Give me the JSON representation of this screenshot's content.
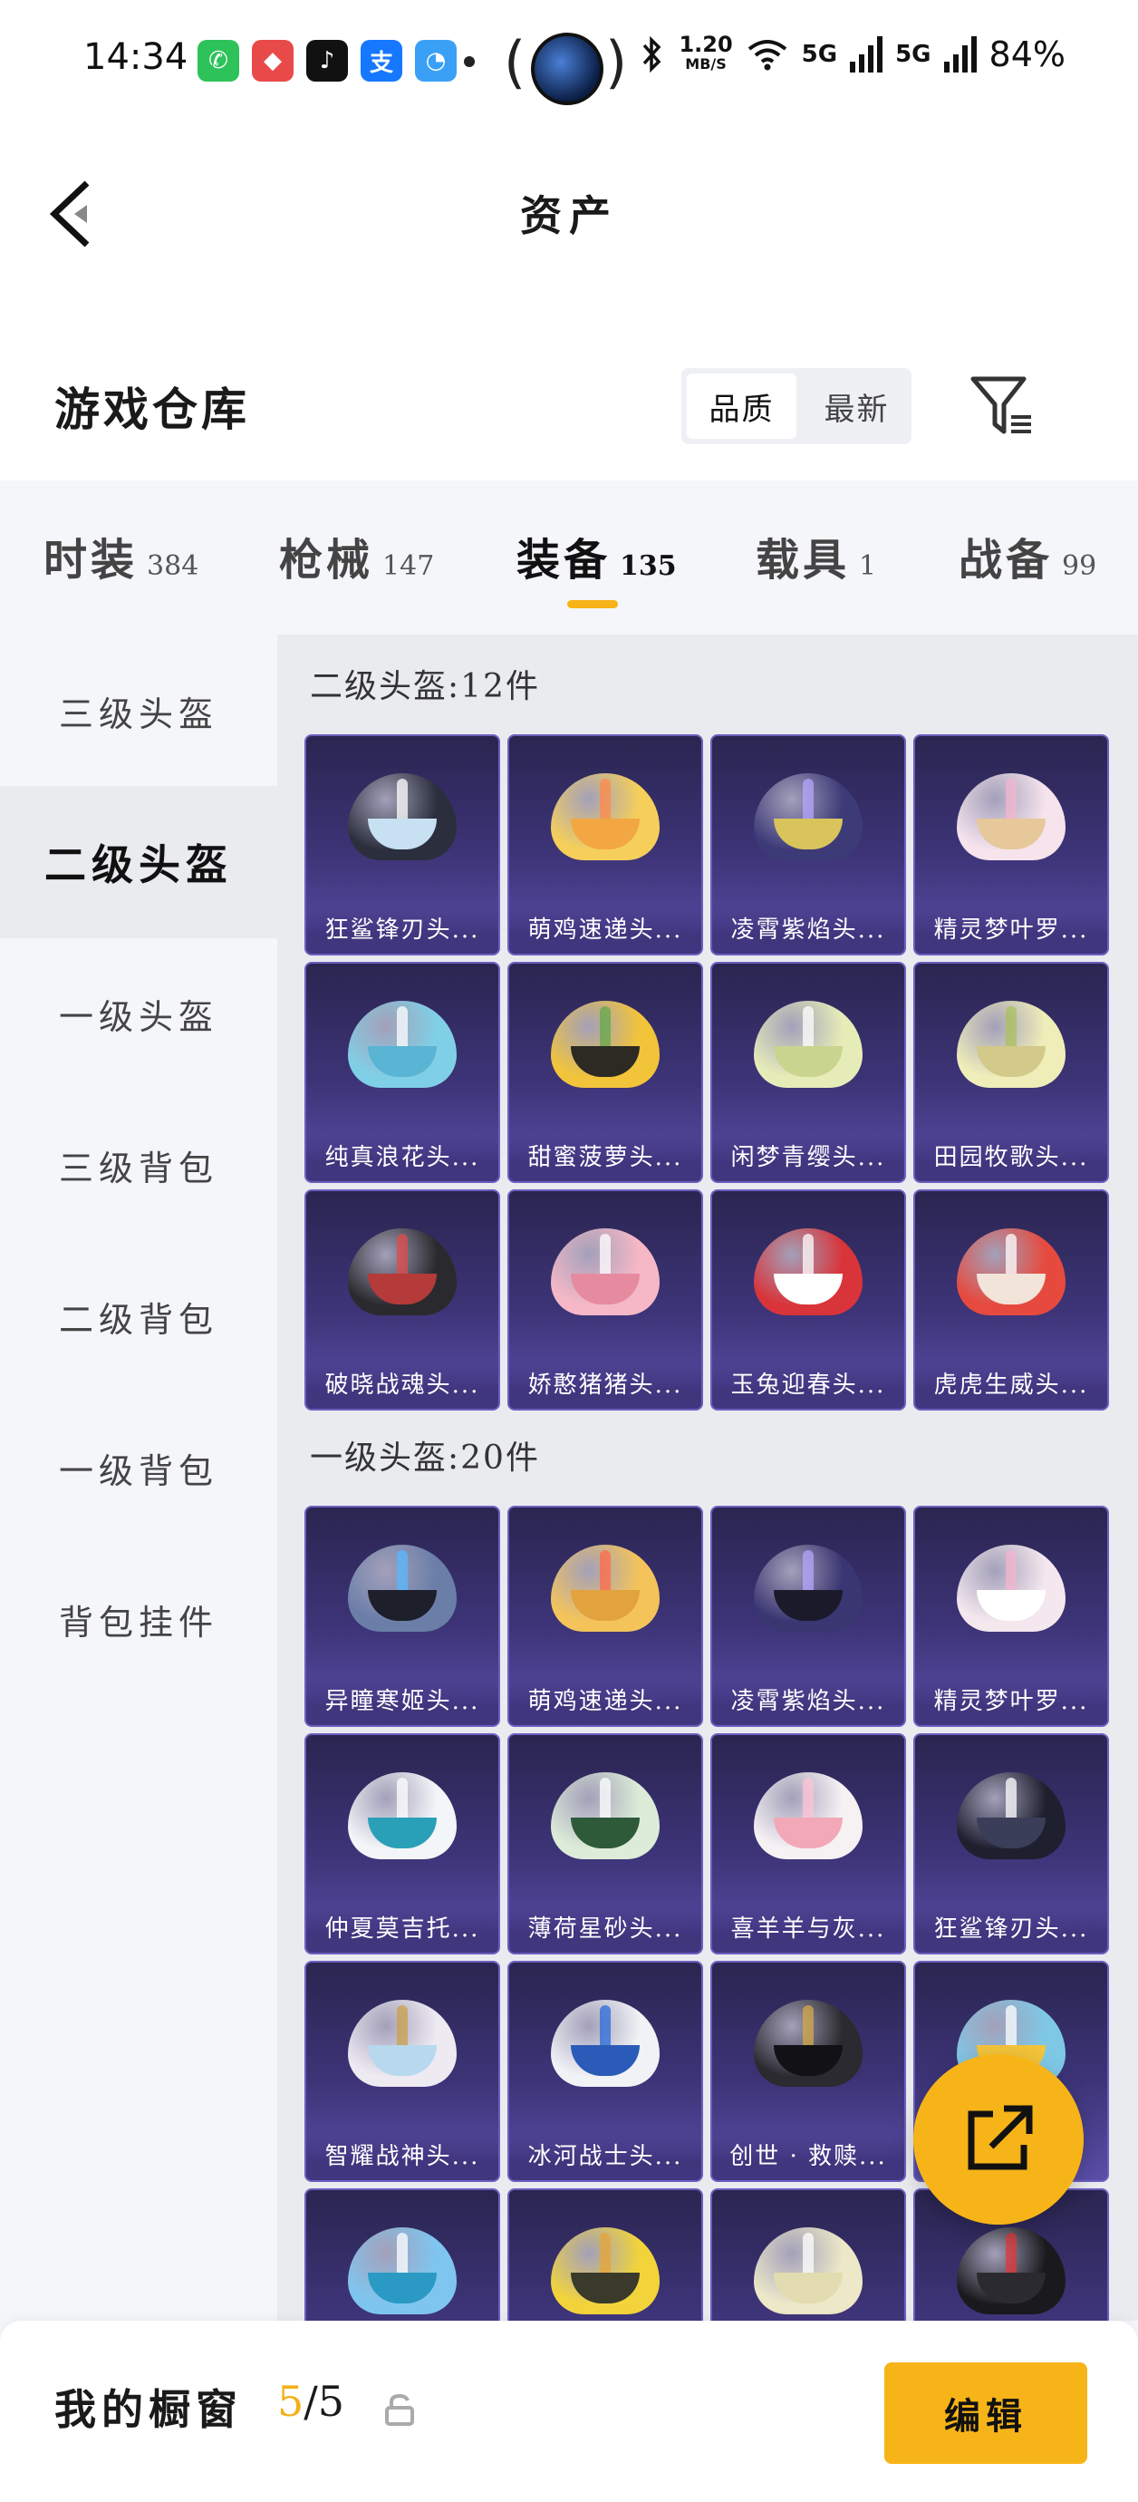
{
  "status_bar": {
    "time": "14:34",
    "speed_value": "1.20",
    "speed_unit": "MB/S",
    "signal1": "5G",
    "signal2": "5G",
    "battery": "84%",
    "apps": [
      {
        "icon": "wechat-icon",
        "glyph": "✆",
        "color": "#2ec25a"
      },
      {
        "icon": "game-app-icon",
        "glyph": "◆",
        "color": "#e84a4a"
      },
      {
        "icon": "tiktok-icon",
        "glyph": "♪",
        "color": "#111111"
      },
      {
        "icon": "alipay-icon",
        "glyph": "支",
        "color": "#1677ff"
      },
      {
        "icon": "browser-icon",
        "glyph": "◔",
        "color": "#3aa0f5"
      }
    ]
  },
  "header": {
    "title": "资产"
  },
  "section": {
    "title": "游戏仓库",
    "sort_options": [
      "品质",
      "最新"
    ],
    "sort_active": "品质"
  },
  "category_tabs": [
    {
      "label": "时装",
      "count": "384",
      "active": false
    },
    {
      "label": "枪械",
      "count": "147",
      "active": false
    },
    {
      "label": "装备",
      "count": "135",
      "active": true
    },
    {
      "label": "载具",
      "count": "1",
      "active": false
    },
    {
      "label": "战备",
      "count": "99",
      "active": false
    }
  ],
  "sidebar": {
    "items": [
      "三级头盔",
      "二级头盔",
      "一级头盔",
      "三级背包",
      "二级背包",
      "一级背包",
      "背包挂件"
    ],
    "active_index": 1
  },
  "groups": [
    {
      "title": "二级头盔:12件",
      "items": [
        {
          "name": "狂鲨锋刃头...",
          "color": "#2b2f3d",
          "visor": "#c7e0f2",
          "stripe": "#ffffff"
        },
        {
          "name": "萌鸡速递头...",
          "color": "#f6cf5a",
          "visor": "#f2a742",
          "stripe": "#ff8a4a"
        },
        {
          "name": "凌霄紫焰头...",
          "color": "#3d3a78",
          "visor": "#d9c35b",
          "stripe": "#b6a6ff"
        },
        {
          "name": "精灵梦叶罗...",
          "color": "#f6e3ec",
          "visor": "#e6c89a",
          "stripe": "#f2b6cf"
        },
        {
          "name": "纯真浪花头...",
          "color": "#7fd0e6",
          "visor": "#5ab4d4",
          "stripe": "#ffffff"
        },
        {
          "name": "甜蜜菠萝头...",
          "color": "#f2c43a",
          "visor": "#2d2a24",
          "stripe": "#63a84a"
        },
        {
          "name": "闲梦青缨头...",
          "color": "#e6ecb8",
          "visor": "#c9d48e",
          "stripe": "#ffffff"
        },
        {
          "name": "田园牧歌头...",
          "color": "#f0eeb8",
          "visor": "#d2c98a",
          "stripe": "#a9c25c"
        },
        {
          "name": "破晓战魂头...",
          "color": "#2a2a2e",
          "visor": "#b53a3a",
          "stripe": "#e14a4a"
        },
        {
          "name": "娇憨猪猪头...",
          "color": "#f6b8c6",
          "visor": "#e68aa0",
          "stripe": "#ffffff"
        },
        {
          "name": "玉兔迎春头...",
          "color": "#d8343a",
          "visor": "#ffffff",
          "stripe": "#ffffff"
        },
        {
          "name": "虎虎生威头...",
          "color": "#e64a3e",
          "visor": "#f2e4d8",
          "stripe": "#ffffff"
        }
      ]
    },
    {
      "title": "一级头盔:20件",
      "items": [
        {
          "name": "异瞳寒姬头...",
          "color": "#6a7ea8",
          "visor": "#1d1f2a",
          "stripe": "#58b8ff"
        },
        {
          "name": "萌鸡速递头...",
          "color": "#f4c45a",
          "visor": "#e2a23e",
          "stripe": "#ff6a4a"
        },
        {
          "name": "凌霄紫焰头...",
          "color": "#3a3672",
          "visor": "#1a1a2a",
          "stripe": "#b6a6ff"
        },
        {
          "name": "精灵梦叶罗...",
          "color": "#f4e8ee",
          "visor": "#ffffff",
          "stripe": "#f2b6cf"
        },
        {
          "name": "仲夏莫吉托...",
          "color": "#f2f6f8",
          "visor": "#2aa0b8",
          "stripe": "#ffffff"
        },
        {
          "name": "薄荷星砂头...",
          "color": "#dcecd8",
          "visor": "#2e5a3a",
          "stripe": "#ffffff"
        },
        {
          "name": "喜羊羊与灰...",
          "color": "#f6f2f4",
          "visor": "#f2a8b6",
          "stripe": "#ffc4d4"
        },
        {
          "name": "狂鲨锋刃头...",
          "color": "#1e2030",
          "visor": "#3a3e58",
          "stripe": "#ffffff"
        },
        {
          "name": "智耀战神头...",
          "color": "#eeeaf2",
          "visor": "#b8d8ee",
          "stripe": "#c9a04a"
        },
        {
          "name": "冰河战士头...",
          "color": "#f0f2f6",
          "visor": "#2a5bb8",
          "stripe": "#2a6ad8"
        },
        {
          "name": "创世 · 救赎...",
          "color": "#2a2a30",
          "visor": "#111116",
          "stripe": "#d6a84a"
        },
        {
          "name": "",
          "color": "#7ec8e6",
          "visor": "#f2c43a",
          "stripe": "#ffffff"
        },
        {
          "name": "",
          "color": "#7ec6f0",
          "visor": "#2a9ac4",
          "stripe": "#ffffff"
        },
        {
          "name": "",
          "color": "#f2d43a",
          "visor": "#3a3a2a",
          "stripe": "#e6a43a"
        },
        {
          "name": "",
          "color": "#ece8c8",
          "visor": "#e2dcb0",
          "stripe": "#ffffff"
        },
        {
          "name": "",
          "color": "#1a1a1e",
          "visor": "#2a2a30",
          "stripe": "#e0383a"
        }
      ]
    }
  ],
  "bottom": {
    "showcase_label": "我的橱窗",
    "showcase_current": "5",
    "showcase_sep": "/5",
    "edit_label": "编辑"
  },
  "colors": {
    "accent": "#f7b418",
    "card_bg": "#3d3478"
  }
}
